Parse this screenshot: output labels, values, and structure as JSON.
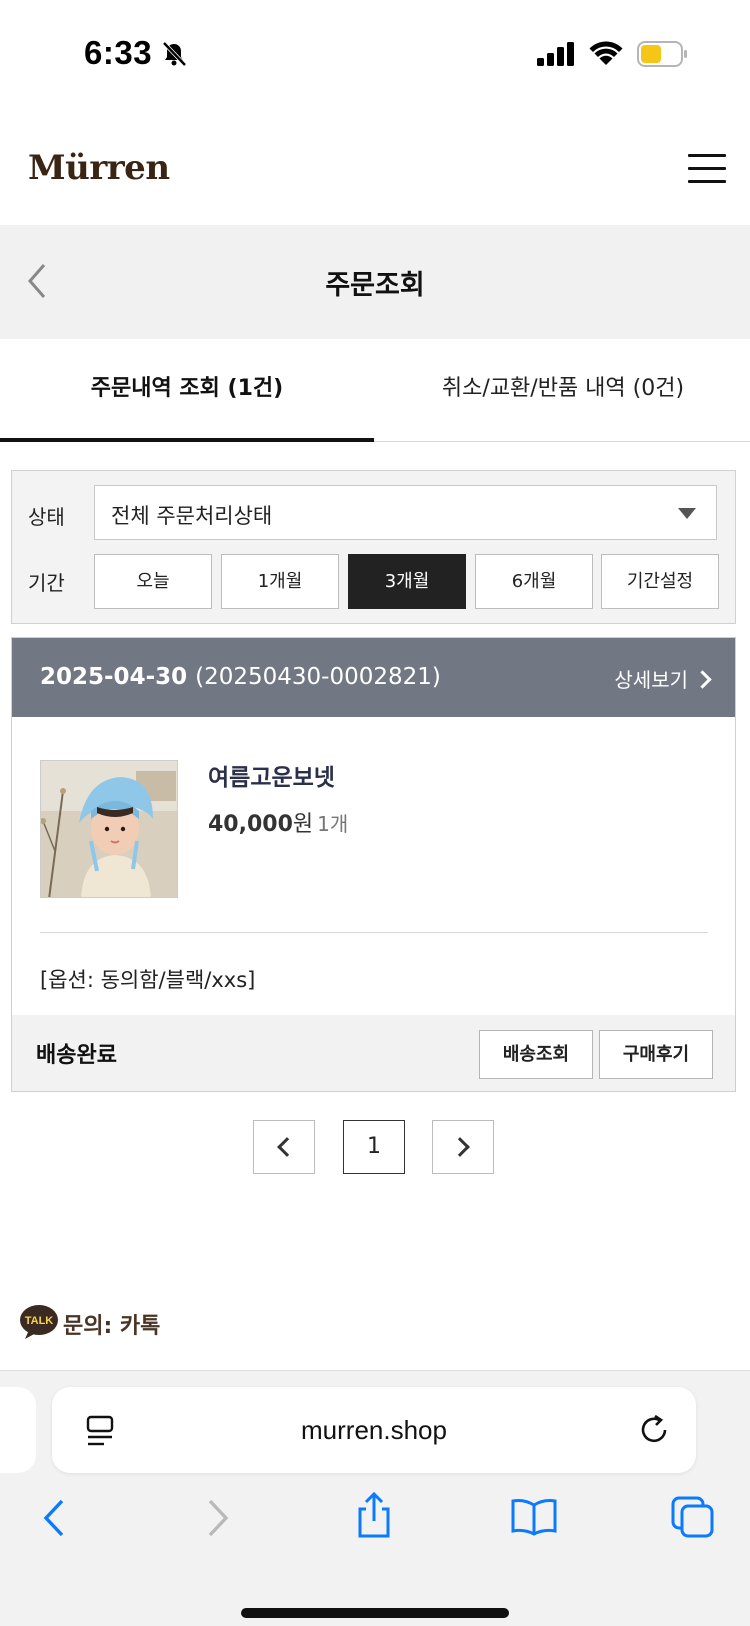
{
  "status_bar": {
    "time": "6:33"
  },
  "header": {
    "logo": "Mürren"
  },
  "title_bar": {
    "title": "주문조회"
  },
  "tabs": [
    {
      "label": "주문내역 조회 (1건)",
      "active": true
    },
    {
      "label": "취소/교환/반품 내역 (0건)",
      "active": false
    }
  ],
  "filters": {
    "status_label": "상태",
    "status_value": "전체 주문처리상태",
    "period_label": "기간",
    "periods": [
      "오늘",
      "1개월",
      "3개월",
      "6개월",
      "기간설정"
    ],
    "active_period": "3개월"
  },
  "order": {
    "date": "2025-04-30",
    "order_number": "(20250430-0002821)",
    "detail_label": "상세보기",
    "product_name": "여름고운보넷",
    "price": "40,000",
    "price_unit": "원",
    "quantity": "1개",
    "option": "[옵션: 동의함/블랙/xxs]",
    "delivery_status": "배송완료",
    "buttons": [
      "배송조회",
      "구매후기"
    ]
  },
  "pagination": {
    "current_page": "1"
  },
  "kakao": {
    "badge": "TALK",
    "label": "문의: 카톡"
  },
  "browser": {
    "url": "murren.shop"
  },
  "colors": {
    "order_header_bg": "#727784",
    "active_period_bg": "#222222",
    "logo": "#3a2414",
    "safari_blue": "#0a7aff",
    "battery_fill": "#f5c518"
  }
}
